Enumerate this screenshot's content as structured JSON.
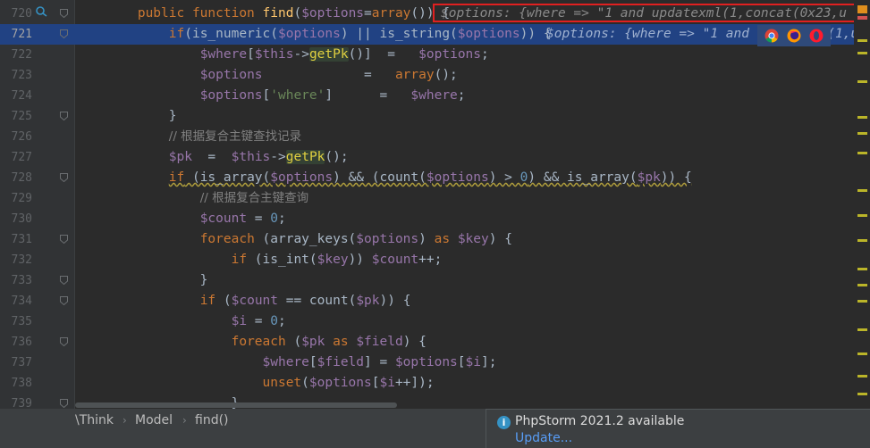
{
  "editor": {
    "lines": [
      {
        "n": "720",
        "tokens": [
          {
            "t": "        "
          },
          {
            "t": "public function ",
            "c": "kw"
          },
          {
            "t": "find",
            "c": "fn"
          },
          {
            "t": "("
          },
          {
            "t": "$options",
            "c": "var"
          },
          {
            "t": "="
          },
          {
            "t": "array",
            "c": "kw"
          },
          {
            "t": "()) {"
          }
        ]
      },
      {
        "n": "721",
        "tokens": [
          {
            "t": "            "
          },
          {
            "t": "if",
            "c": "kw"
          },
          {
            "t": "(is_numeric("
          },
          {
            "t": "$options",
            "c": "var"
          },
          {
            "t": ") || is_string("
          },
          {
            "t": "$options",
            "c": "var"
          },
          {
            "t": ")) {"
          }
        ]
      },
      {
        "n": "722",
        "tokens": [
          {
            "t": "                "
          },
          {
            "t": "$where",
            "c": "var"
          },
          {
            "t": "["
          },
          {
            "t": "$this",
            "c": "var"
          },
          {
            "t": "->"
          },
          {
            "t": "getPk",
            "c": "hl"
          },
          {
            "t": "()]  =   "
          },
          {
            "t": "$options",
            "c": "var"
          },
          {
            "t": ";"
          }
        ]
      },
      {
        "n": "723",
        "tokens": [
          {
            "t": "                "
          },
          {
            "t": "$options",
            "c": "var"
          },
          {
            "t": "             =   "
          },
          {
            "t": "array",
            "c": "kw"
          },
          {
            "t": "();"
          }
        ]
      },
      {
        "n": "724",
        "tokens": [
          {
            "t": "                "
          },
          {
            "t": "$options",
            "c": "var"
          },
          {
            "t": "["
          },
          {
            "t": "'where'",
            "c": "str"
          },
          {
            "t": "]      =   "
          },
          {
            "t": "$where",
            "c": "var"
          },
          {
            "t": ";"
          }
        ]
      },
      {
        "n": "725",
        "tokens": [
          {
            "t": "            }"
          }
        ]
      },
      {
        "n": "726",
        "tokens": [
          {
            "t": "            "
          },
          {
            "t": "// 根据复合主键查找记录",
            "c": "cmt"
          }
        ]
      },
      {
        "n": "727",
        "tokens": [
          {
            "t": "            "
          },
          {
            "t": "$pk",
            "c": "var"
          },
          {
            "t": "  =  "
          },
          {
            "t": "$this",
            "c": "var"
          },
          {
            "t": "->"
          },
          {
            "t": "getPk",
            "c": "hl"
          },
          {
            "t": "();"
          }
        ]
      },
      {
        "n": "728",
        "tokens": [
          {
            "t": "            "
          },
          {
            "t": "if",
            "c": "kw wavy"
          },
          {
            "t": " (is_array(",
            "c": "wavy"
          },
          {
            "t": "$options",
            "c": "var wavy"
          },
          {
            "t": ") && (count(",
            "c": "wavy"
          },
          {
            "t": "$options",
            "c": "var wavy"
          },
          {
            "t": ") > ",
            "c": "wavy"
          },
          {
            "t": "0",
            "c": "num wavy"
          },
          {
            "t": ") && is_array(",
            "c": "wavy"
          },
          {
            "t": "$pk",
            "c": "var wavy"
          },
          {
            "t": ")) {",
            "c": "wavy"
          }
        ]
      },
      {
        "n": "729",
        "tokens": [
          {
            "t": "                "
          },
          {
            "t": "// 根据复合主键查询",
            "c": "cmt"
          }
        ]
      },
      {
        "n": "730",
        "tokens": [
          {
            "t": "                "
          },
          {
            "t": "$count",
            "c": "var"
          },
          {
            "t": " = "
          },
          {
            "t": "0",
            "c": "num"
          },
          {
            "t": ";"
          }
        ]
      },
      {
        "n": "731",
        "tokens": [
          {
            "t": "                "
          },
          {
            "t": "foreach",
            "c": "kw"
          },
          {
            "t": " (array_keys("
          },
          {
            "t": "$options",
            "c": "var"
          },
          {
            "t": ") "
          },
          {
            "t": "as",
            "c": "kw"
          },
          {
            "t": " "
          },
          {
            "t": "$key",
            "c": "var"
          },
          {
            "t": ") {"
          }
        ]
      },
      {
        "n": "732",
        "tokens": [
          {
            "t": "                    "
          },
          {
            "t": "if",
            "c": "kw"
          },
          {
            "t": " (is_int("
          },
          {
            "t": "$key",
            "c": "var"
          },
          {
            "t": ")) "
          },
          {
            "t": "$count",
            "c": "var"
          },
          {
            "t": "++;"
          }
        ]
      },
      {
        "n": "733",
        "tokens": [
          {
            "t": "                }"
          }
        ]
      },
      {
        "n": "734",
        "tokens": [
          {
            "t": "                "
          },
          {
            "t": "if",
            "c": "kw"
          },
          {
            "t": " ("
          },
          {
            "t": "$count",
            "c": "var"
          },
          {
            "t": " == count("
          },
          {
            "t": "$pk",
            "c": "var"
          },
          {
            "t": ")) {"
          }
        ]
      },
      {
        "n": "735",
        "tokens": [
          {
            "t": "                    "
          },
          {
            "t": "$i",
            "c": "var"
          },
          {
            "t": " = "
          },
          {
            "t": "0",
            "c": "num"
          },
          {
            "t": ";"
          }
        ]
      },
      {
        "n": "736",
        "tokens": [
          {
            "t": "                    "
          },
          {
            "t": "foreach",
            "c": "kw"
          },
          {
            "t": " ("
          },
          {
            "t": "$pk",
            "c": "var"
          },
          {
            "t": " "
          },
          {
            "t": "as",
            "c": "kw"
          },
          {
            "t": " "
          },
          {
            "t": "$field",
            "c": "var"
          },
          {
            "t": ") {"
          }
        ]
      },
      {
        "n": "737",
        "tokens": [
          {
            "t": "                        "
          },
          {
            "t": "$where",
            "c": "var"
          },
          {
            "t": "["
          },
          {
            "t": "$field",
            "c": "var"
          },
          {
            "t": "] = "
          },
          {
            "t": "$options",
            "c": "var"
          },
          {
            "t": "["
          },
          {
            "t": "$i",
            "c": "var"
          },
          {
            "t": "];"
          }
        ]
      },
      {
        "n": "738",
        "tokens": [
          {
            "t": "                        "
          },
          {
            "t": "unset",
            "c": "kw"
          },
          {
            "t": "("
          },
          {
            "t": "$options",
            "c": "var"
          },
          {
            "t": "["
          },
          {
            "t": "$i",
            "c": "var"
          },
          {
            "t": "++]);"
          }
        ]
      },
      {
        "n": "739",
        "tokens": [
          {
            "t": "                    }"
          }
        ]
      }
    ],
    "current_line": "721",
    "hints": {
      "line720": "$options: {where => \"1 and updatexml(1,concat(0x23,u",
      "line721": "$options: {where => \"1 and updatexml(1,u"
    },
    "colors": {
      "background": "#2b2b2b",
      "gutter": "#313335",
      "current_line": "#214283",
      "highlight_box": "#e02020",
      "keyword": "#cc7832",
      "variable": "#9876aa",
      "string": "#6a8759",
      "number": "#6897bb",
      "comment": "#808080"
    },
    "browser_icons": [
      "chrome-icon",
      "firefox-icon",
      "opera-icon"
    ]
  },
  "breadcrumb": {
    "items": [
      "\\Think",
      "Model",
      "find()"
    ],
    "separator": "›"
  },
  "notification": {
    "title": "PhpStorm 2021.2 available",
    "action": "Update..."
  }
}
